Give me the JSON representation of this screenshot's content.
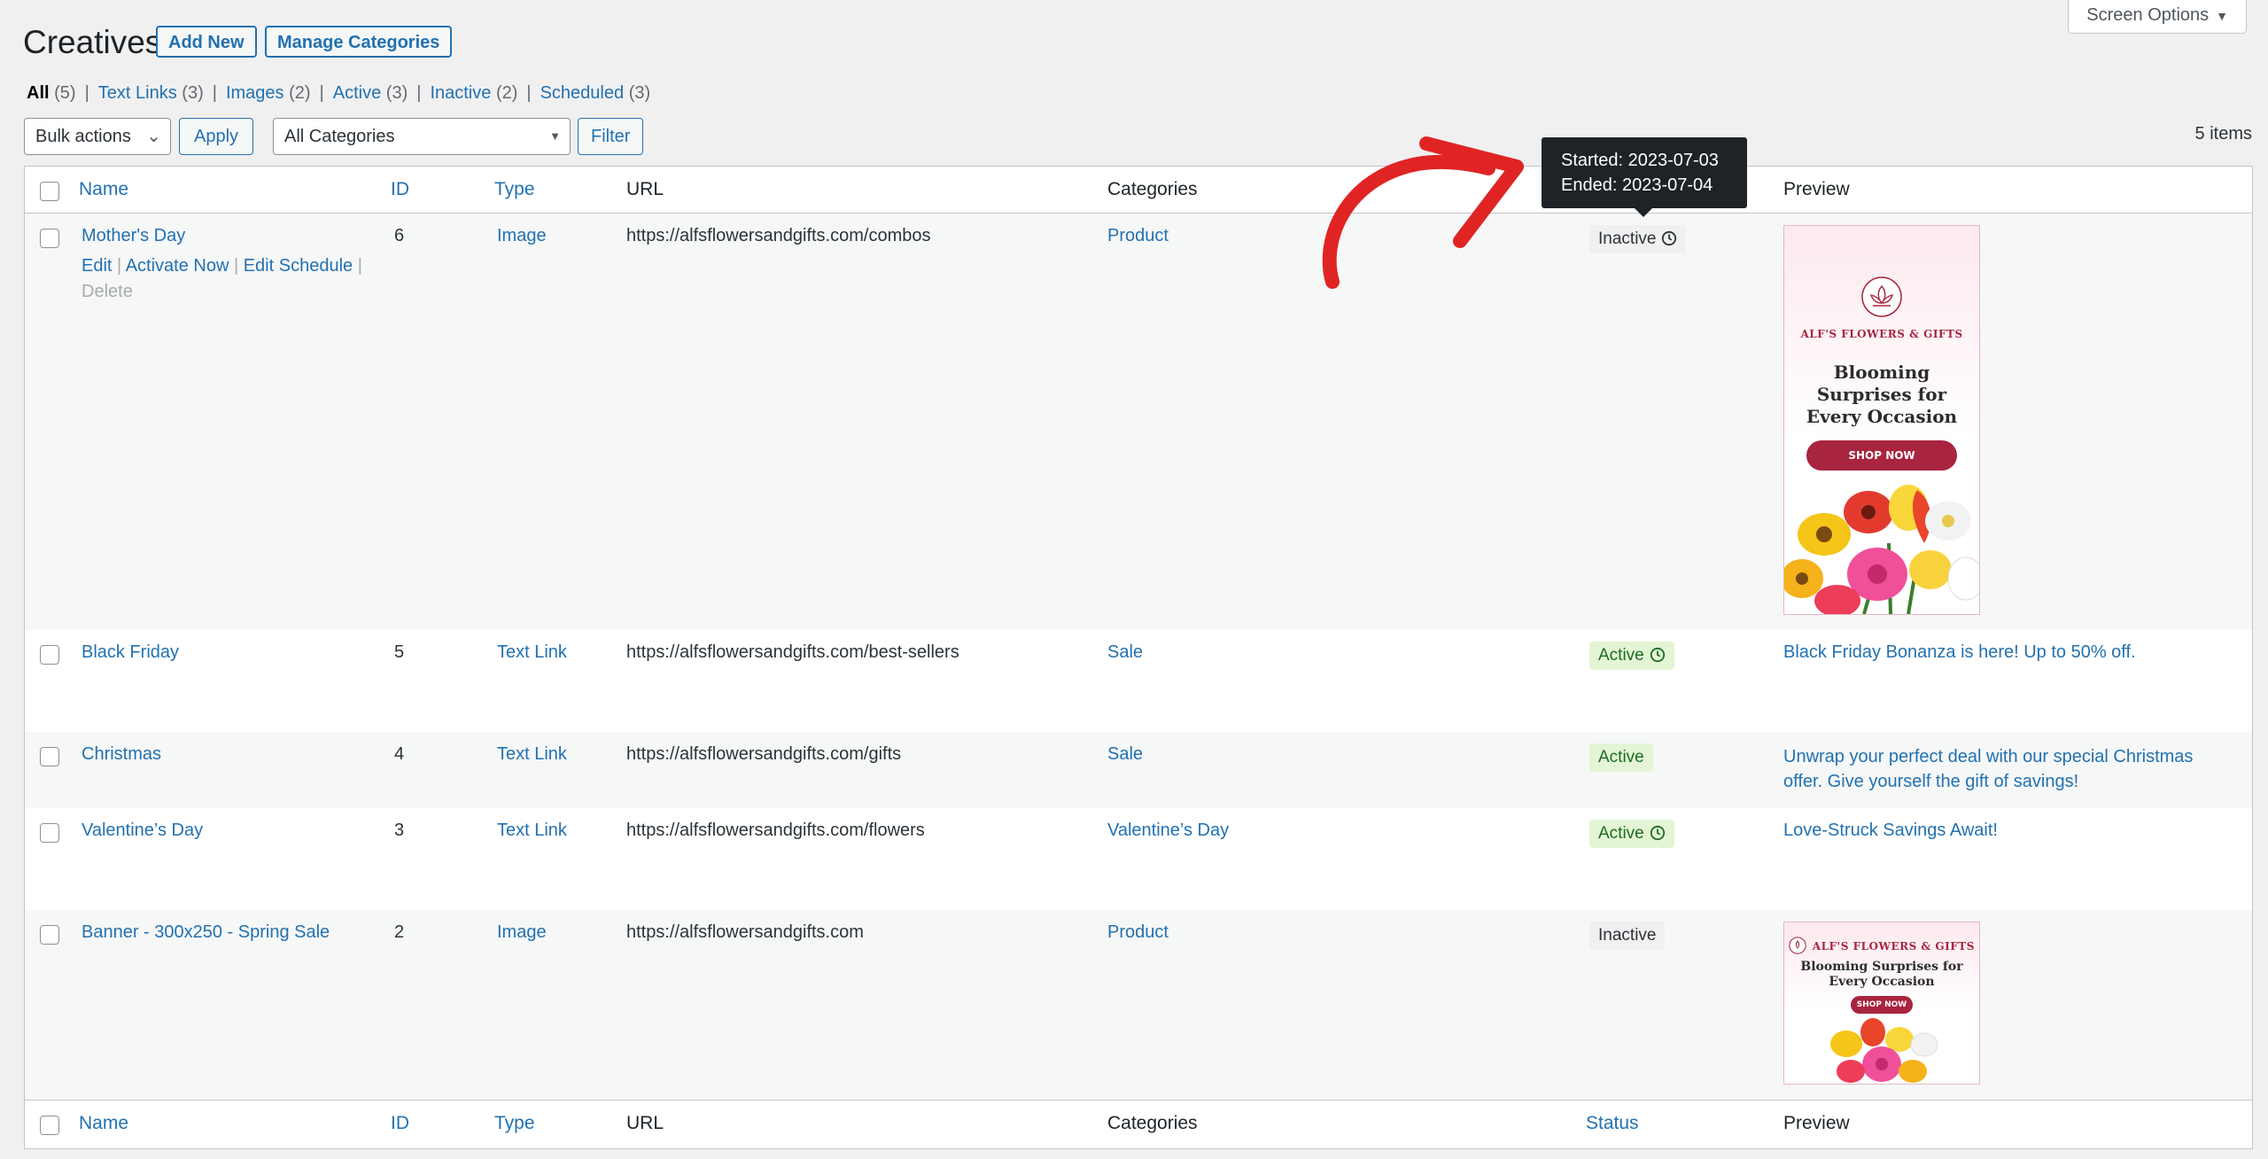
{
  "page": {
    "title": "Creatives",
    "add_new": "Add New",
    "manage_categories": "Manage Categories"
  },
  "screen_options": {
    "label": "Screen Options"
  },
  "views": [
    {
      "label": "All",
      "count": "(5)"
    },
    {
      "label": "Text Links",
      "count": "(3)"
    },
    {
      "label": "Images",
      "count": "(2)"
    },
    {
      "label": "Active",
      "count": "(3)"
    },
    {
      "label": "Inactive",
      "count": "(2)"
    },
    {
      "label": "Scheduled",
      "count": "(3)"
    }
  ],
  "tablenav": {
    "bulk_actions": "Bulk actions",
    "apply": "Apply",
    "category_filter": "All Categories",
    "filter": "Filter",
    "items_count": "5 items"
  },
  "columns": {
    "name": "Name",
    "id": "ID",
    "type": "Type",
    "url": "URL",
    "categories": "Categories",
    "status": "Status",
    "preview": "Preview"
  },
  "row_actions": {
    "edit": "Edit",
    "activate_now": "Activate Now",
    "edit_schedule": "Edit Schedule",
    "delete": "Delete"
  },
  "tooltip": {
    "started": "Started: 2023-07-03",
    "ended": "Ended: 2023-07-04"
  },
  "rows": [
    {
      "name": "Mother's Day",
      "id": "6",
      "type": "Image",
      "url": "https://alfsflowersandgifts.com/combos",
      "category": "Product",
      "status": "Inactive",
      "scheduled": true
    },
    {
      "name": "Black Friday",
      "id": "5",
      "type": "Text Link",
      "url": "https://alfsflowersandgifts.com/best-sellers",
      "category": "Sale",
      "status": "Active",
      "scheduled": true,
      "preview": "Black Friday Bonanza is here! Up to 50% off."
    },
    {
      "name": "Christmas",
      "id": "4",
      "type": "Text Link",
      "url": "https://alfsflowersandgifts.com/gifts",
      "category": "Sale",
      "status": "Active",
      "scheduled": false,
      "preview_line1": "Unwrap your perfect deal with our special Christmas",
      "preview_line2": "offer. Give yourself the gift of savings!"
    },
    {
      "name": "Valentine’s Day",
      "id": "3",
      "type": "Text Link",
      "url": "https://alfsflowersandgifts.com/flowers",
      "category": "Valentine’s Day",
      "status": "Active",
      "scheduled": true,
      "preview": "Love-Struck Savings Await!"
    },
    {
      "name": "Banner - 300x250 - Spring Sale",
      "id": "2",
      "type": "Image",
      "url": "https://alfsflowersandgifts.com",
      "category": "Product",
      "status": "Inactive",
      "scheduled": false
    }
  ],
  "banner": {
    "brand": "ALF'S FLOWERS & GIFTS",
    "headline1": "Blooming",
    "headline2": "Surprises for",
    "headline3": "Every Occasion",
    "headline_wide1": "Blooming Surprises for",
    "headline_wide2": "Every Occasion",
    "cta": "SHOP NOW"
  },
  "colors": {
    "link": "#2271b1",
    "danger": "#b32d2e",
    "active_bg": "#e3f5d5",
    "active_text": "#1e6b22",
    "annotation_arrow": "#e02424",
    "banner_accent": "#a8243f"
  }
}
